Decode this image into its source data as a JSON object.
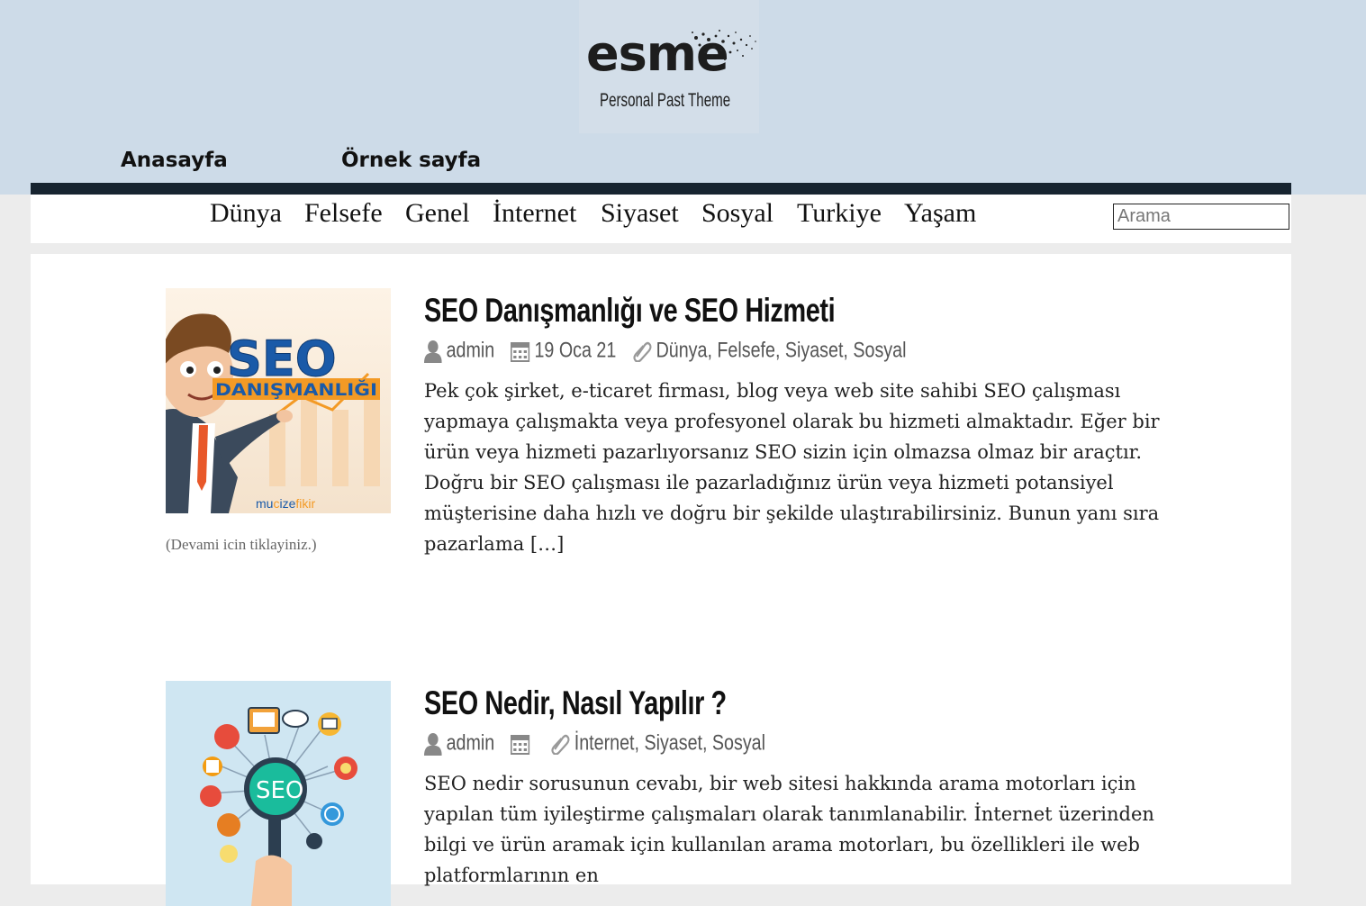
{
  "site": {
    "logo_word": "esme",
    "logo_tagline": "Personal Past Theme"
  },
  "top_nav": {
    "items": [
      {
        "label": "Anasayfa"
      },
      {
        "label": "Örnek sayfa"
      }
    ]
  },
  "category_nav": {
    "items": [
      {
        "label": "Dünya"
      },
      {
        "label": "Felsefe"
      },
      {
        "label": "Genel"
      },
      {
        "label": "İnternet"
      },
      {
        "label": "Siyaset"
      },
      {
        "label": "Sosyal"
      },
      {
        "label": "Turkiye"
      },
      {
        "label": "Yaşam"
      }
    ]
  },
  "search": {
    "placeholder": "Arama",
    "value": ""
  },
  "posts": [
    {
      "title": "SEO Danışmanlığı ve SEO Hizmeti",
      "author": "admin",
      "date": "19 Oca 21",
      "categories": [
        "Dünya",
        "Felsefe",
        "Siyaset",
        "Sosyal"
      ],
      "excerpt": "Pek çok şirket, e-ticaret firması, blog veya web site sahibi SEO çalışması yapmaya çalışmakta veya profesyonel olarak bu hizmeti almaktadır. Eğer bir ürün veya hizmeti pazarlıyorsanız SEO sizin için olmazsa olmaz bir araçtır. Doğru bir SEO çalışması ile pazarladığınız ürün veya hizmeti potansiyel müşterisine daha hızlı ve doğru bir şekilde ulaştırabilirsiniz. Bunun yanı sıra pazarlama […]",
      "more_link": "(Devami icin tiklayiniz.)",
      "thumb": {
        "headline": "SEO",
        "subline": "DANIŞMANLIĞI",
        "brand_pre": "mu",
        "brand_mid": "c",
        "brand_post": "ize",
        "brand_suffix": "fikir"
      }
    },
    {
      "title": "SEO Nedir, Nasıl Yapılır ?",
      "author": "admin",
      "date": "",
      "categories": [
        "İnternet",
        "Siyaset",
        "Sosyal"
      ],
      "excerpt": "SEO nedir sorusunun cevabı, bir web sitesi hakkında arama motorları için yapılan tüm iyileştirme çalışmaları olarak tanımlanabilir. İnternet üzerinden bilgi ve ürün aramak için kullanılan arama motorları, bu özellikleri ile web platformlarının en",
      "thumb": {
        "headline": "SEO"
      }
    }
  ],
  "colors": {
    "header_bg": "#cddbe8",
    "nav_bar": "#172430",
    "page_bg": "#ececec",
    "content_bg": "#ffffff",
    "seo_blue": "#1a5aa8",
    "seo_orange": "#f39a25"
  }
}
